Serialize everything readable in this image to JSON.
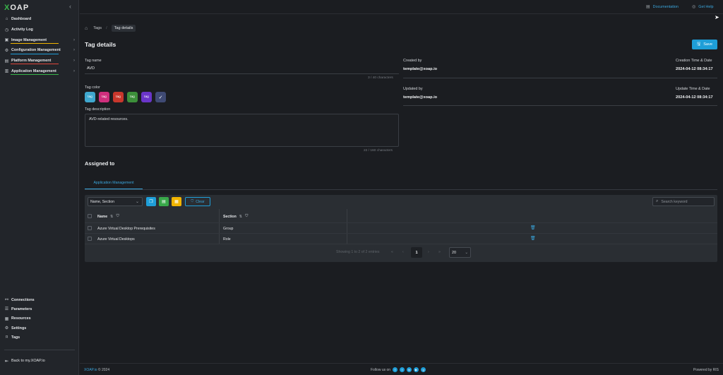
{
  "app": {
    "logo": "XOAP"
  },
  "sidebar": {
    "items": [
      {
        "label": "Dashboard",
        "icon": "home-icon"
      },
      {
        "label": "Activity Log",
        "icon": "clock-icon"
      },
      {
        "label": "Image Management",
        "icon": "image-icon",
        "accent": "#f0b400"
      },
      {
        "label": "Configuration Management",
        "icon": "config-icon",
        "accent": "#1e9ed8"
      },
      {
        "label": "Platform Management",
        "icon": "platform-icon",
        "accent": "#e0463a"
      },
      {
        "label": "Application Management",
        "icon": "app-icon",
        "accent": "#39b54a"
      }
    ],
    "bottom_items": [
      {
        "label": "Connections",
        "icon": "link-icon"
      },
      {
        "label": "Parameters",
        "icon": "list-icon"
      },
      {
        "label": "Resources",
        "icon": "grid-icon"
      },
      {
        "label": "Settings",
        "icon": "gear-icon"
      },
      {
        "label": "Tags",
        "icon": "tag-icon"
      }
    ],
    "back_link": "Back to my.XOAP.io"
  },
  "topbar": {
    "documentation": "Documentation",
    "get_help": "Get Help"
  },
  "breadcrumb": {
    "tags": "Tags",
    "current": "Tag details"
  },
  "page": {
    "title": "Tag details",
    "save_label": "Save"
  },
  "form": {
    "tag_name_label": "Tag name",
    "tag_name_value": "AVD",
    "tag_name_counter": "3 / 40 characters",
    "tag_color_label": "Tag color",
    "colors": [
      {
        "label": "tag",
        "color": "#3fa8cf"
      },
      {
        "label": "tag",
        "color": "#cf2f7d"
      },
      {
        "label": "tag",
        "color": "#c8372c"
      },
      {
        "label": "tag",
        "color": "#3c8f3a"
      },
      {
        "label": "tag",
        "color": "#6a35c9"
      },
      {
        "label": "✓",
        "color": "#3f4a74"
      }
    ],
    "tag_description_label": "Tag description",
    "tag_description_value": "AVD-related resources.",
    "tag_description_counter": "22 / 160 characters"
  },
  "meta": {
    "created_by_label": "Created by",
    "created_by_value": "template@xoap.io",
    "creation_time_label": "Creation Time & Date",
    "creation_time_value": "2024-04-12 08:34:17",
    "updated_by_label": "Updated by",
    "updated_by_value": "template@xoap.io",
    "update_time_label": "Update Time & Date",
    "update_time_value": "2024-04-12 08:34:17"
  },
  "assigned": {
    "title": "Assigned to",
    "tab": "Application Management",
    "filter_select": "Name, Section",
    "clear_label": "Clear",
    "search_placeholder": "Search keyword",
    "columns": {
      "name": "Name",
      "section": "Section"
    },
    "rows": [
      {
        "name": "Azure Virtual Desktop Prerequisites",
        "section": "Group"
      },
      {
        "name": "Azure Virtual Desktops",
        "section": "Role"
      }
    ],
    "pagination": {
      "summary": "Showing 1 to 2 of 2 entries",
      "current_page": "1",
      "page_size": "20"
    }
  },
  "footer": {
    "brand": "XOAP.io",
    "year": "© 2024",
    "follow": "Follow us on",
    "powered": "Powered by RIS"
  }
}
